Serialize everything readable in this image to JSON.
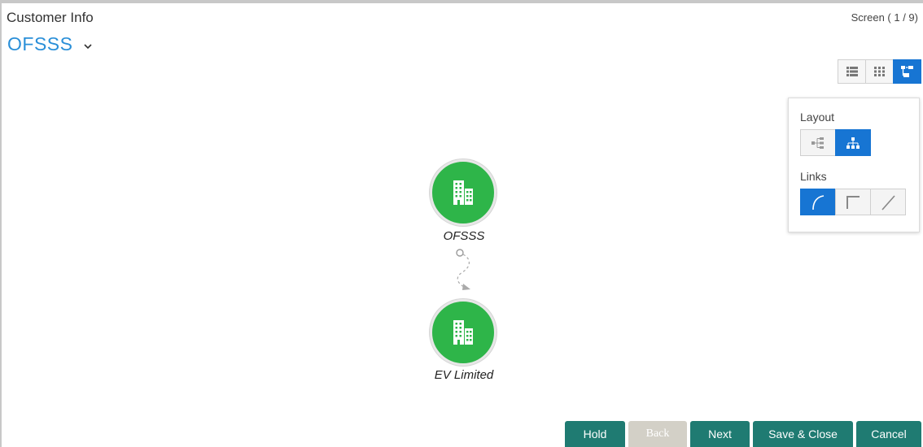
{
  "header": {
    "section_title": "Customer Info",
    "screen_counter": "Screen ( 1 / 9)"
  },
  "entity_selector": {
    "value": "OFSSS",
    "icon": "chevron-down-icon"
  },
  "view_toggle": {
    "buttons": [
      {
        "icon": "list-view-icon",
        "active": false
      },
      {
        "icon": "grid-view-icon",
        "active": false
      },
      {
        "icon": "hierarchy-view-icon",
        "active": true
      }
    ]
  },
  "options_panel": {
    "layout_label": "Layout",
    "layout_buttons": [
      {
        "icon": "horizontal-tree-icon",
        "active": false
      },
      {
        "icon": "vertical-tree-icon",
        "active": true
      }
    ],
    "links_label": "Links",
    "link_buttons": [
      {
        "icon": "curved-link-icon",
        "active": true
      },
      {
        "icon": "orthogonal-link-icon",
        "active": false
      },
      {
        "icon": "straight-link-icon",
        "active": false
      }
    ]
  },
  "graph": {
    "nodes": [
      {
        "label": "OFSSS",
        "icon": "building-icon"
      },
      {
        "label": "EV Limited",
        "icon": "building-icon"
      }
    ],
    "node_color": "#2eb549",
    "link_style": "curved-dashed"
  },
  "footer": {
    "hold": "Hold",
    "back": "Back",
    "next": "Next",
    "save_close": "Save & Close",
    "cancel": "Cancel"
  },
  "colors": {
    "accent_blue": "#1775d3",
    "entity_text": "#2a8fd8",
    "footer_teal": "#1f7b72",
    "footer_disabled": "#d3d0c7"
  }
}
